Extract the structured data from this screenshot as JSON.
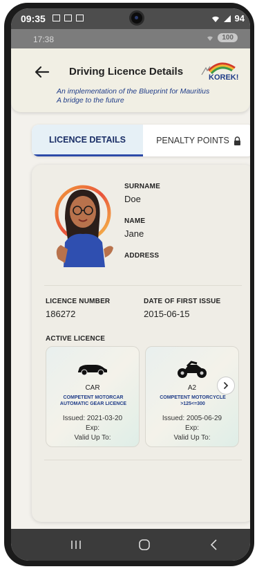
{
  "status_outer": {
    "time": "09:35",
    "right": "94"
  },
  "status_inner": {
    "time": "17:38",
    "pill": "100"
  },
  "header": {
    "title": "Driving Licence Details",
    "logo_text": "KOREK!",
    "tagline_1": "An implementation of the Blueprint for Mauritius",
    "tagline_2": "A bridge to the future"
  },
  "tabs": [
    {
      "label": "LICENCE DETAILS",
      "active": true
    },
    {
      "label": "PENALTY POINTS",
      "icon": "lock-icon"
    }
  ],
  "person": {
    "surname_label": "SURNAME",
    "surname": "Doe",
    "name_label": "NAME",
    "name": "Jane",
    "address_label": "ADDRESS"
  },
  "licence": {
    "number_label": "LICENCE NUMBER",
    "number": "186272",
    "first_issue_label": "DATE OF FIRST ISSUE",
    "first_issue": "2015-06-15",
    "active_label": "ACTIVE LICENCE"
  },
  "licences": [
    {
      "icon": "car-icon",
      "code": "CAR",
      "desc_1": "COMPETENT MOTORCAR",
      "desc_2": "AUTOMATIC GEAR LICENCE",
      "issued": "Issued: 2021-03-20",
      "exp": "Exp:",
      "valid": "Valid Up To:"
    },
    {
      "icon": "motorcycle-icon",
      "code": "A2",
      "desc_1": "COMPETENT MOTORCYCLE",
      "desc_2": ">125<=300",
      "issued": "Issued: 2005-06-29",
      "exp": "Exp:",
      "valid": "Valid Up To:"
    }
  ],
  "colors": {
    "accent": "#1f3c88",
    "tab_active_bg": "#e6f0f6",
    "navbar": "#3b3b3b"
  }
}
